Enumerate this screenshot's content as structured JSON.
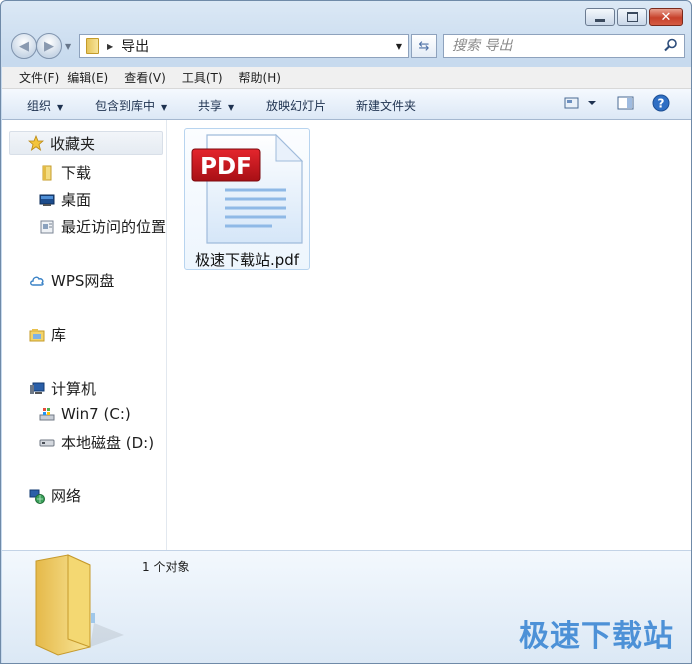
{
  "window": {
    "caption_buttons": [
      "minimize-icon",
      "maximize-icon",
      "close-icon"
    ],
    "close_glyph": "✕"
  },
  "address_bar": {
    "path": "导出",
    "search_placeholder": "搜索 导出"
  },
  "menu": [
    "文件(F)",
    "编辑(E)",
    "查看(V)",
    "工具(T)",
    "帮助(H)"
  ],
  "toolbar": {
    "organize": "组织",
    "include_in_library": "包含到库中",
    "share": "共享",
    "slideshow": "放映幻灯片",
    "new_folder": "新建文件夹",
    "help_glyph": "?"
  },
  "nav_pane": {
    "favorites": "收藏夹",
    "downloads": "下载",
    "desktop": "桌面",
    "recent": "最近访问的位置",
    "wps_cloud": "WPS网盘",
    "libraries": "库",
    "computer": "计算机",
    "drive_c": "Win7 (C:)",
    "drive_d": "本地磁盘 (D:)",
    "network": "网络"
  },
  "files": [
    {
      "name": "极速下载站.pdf",
      "badge": "PDF",
      "icon": "pdf-file-icon"
    }
  ],
  "status": {
    "item_count": "1 个对象"
  },
  "watermark": "极速下载站",
  "colors": {
    "pdf_red": "#c8161d",
    "selection_border": "#b8d4ef",
    "watermark": "#3d88d4"
  }
}
